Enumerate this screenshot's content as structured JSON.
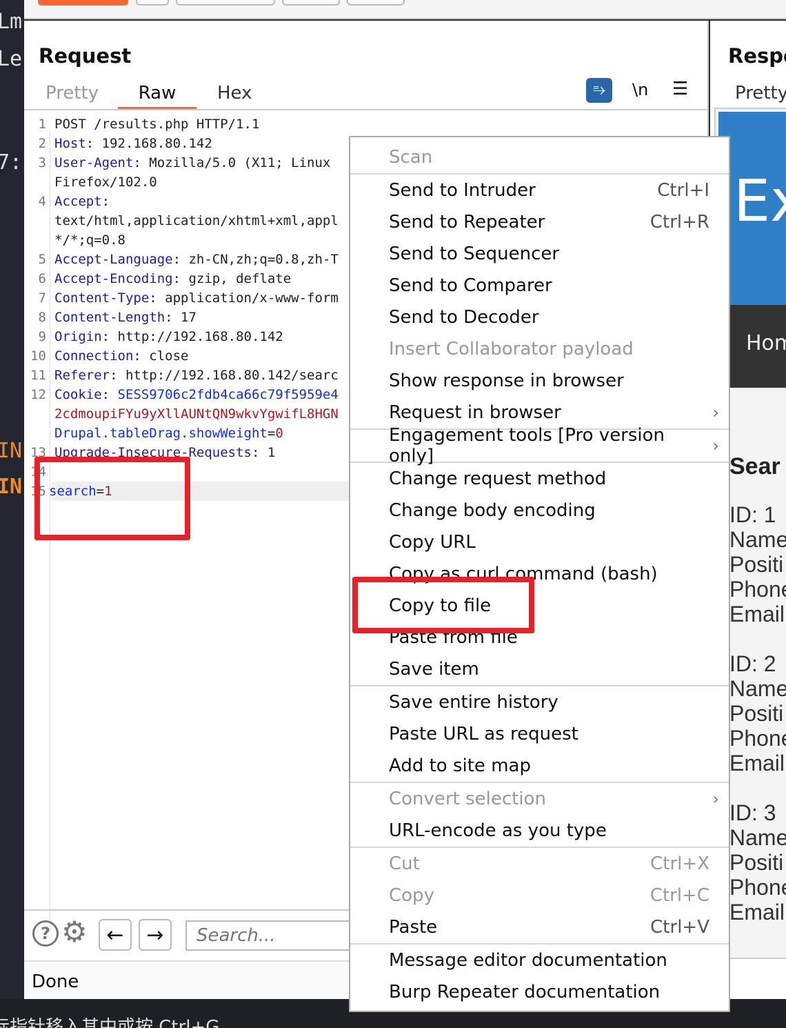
{
  "left_strip": {
    "fragments": [
      "Lm",
      "Le",
      "7:",
      "IN",
      "IN"
    ]
  },
  "request": {
    "title": "Request",
    "tabs": [
      {
        "label": "Pretty",
        "active": false
      },
      {
        "label": "Raw",
        "active": true
      },
      {
        "label": "Hex",
        "active": false
      }
    ],
    "toolbar": {
      "wrap_icon": "wrap-lines-icon",
      "newline_label": "\\n",
      "menu_icon": "hamburger-menu-icon"
    },
    "rows": [
      {
        "n": "1",
        "s": [
          {
            "t": "POST /results.php HTTP/1.1",
            "c": "v"
          }
        ]
      },
      {
        "n": "2",
        "s": [
          {
            "t": "Host",
            "c": "k"
          },
          {
            "t": ": 192.168.80.142",
            "c": "v"
          }
        ]
      },
      {
        "n": "3",
        "s": [
          {
            "t": "User-Agent",
            "c": "k"
          },
          {
            "t": ": Mozilla/5.0 (X11; Linux",
            "c": "v"
          }
        ]
      },
      {
        "n": "",
        "s": [
          {
            "t": "Firefox/102.0",
            "c": "v"
          }
        ]
      },
      {
        "n": "4",
        "s": [
          {
            "t": "Accept",
            "c": "k"
          },
          {
            "t": ":",
            "c": "v"
          }
        ]
      },
      {
        "n": "",
        "s": [
          {
            "t": "text/html,application/xhtml+xml,appl",
            "c": "v"
          }
        ]
      },
      {
        "n": "",
        "s": [
          {
            "t": "*/*;q=0.8",
            "c": "v"
          }
        ]
      },
      {
        "n": "5",
        "s": [
          {
            "t": "Accept-Language",
            "c": "k"
          },
          {
            "t": ": zh-CN,zh;q=0.8,zh-T",
            "c": "v"
          }
        ]
      },
      {
        "n": "6",
        "s": [
          {
            "t": "Accept-Encoding",
            "c": "k"
          },
          {
            "t": ": gzip, deflate",
            "c": "v"
          }
        ]
      },
      {
        "n": "7",
        "s": [
          {
            "t": "Content-Type",
            "c": "k"
          },
          {
            "t": ": application/x-www-form",
            "c": "v"
          }
        ]
      },
      {
        "n": "8",
        "s": [
          {
            "t": "Content-Length",
            "c": "k"
          },
          {
            "t": ": 17",
            "c": "v"
          }
        ]
      },
      {
        "n": "9",
        "s": [
          {
            "t": "Origin",
            "c": "k"
          },
          {
            "t": ": http://192.168.80.142",
            "c": "v"
          }
        ]
      },
      {
        "n": "10",
        "s": [
          {
            "t": "Connection",
            "c": "k"
          },
          {
            "t": ": close",
            "c": "v"
          }
        ]
      },
      {
        "n": "11",
        "s": [
          {
            "t": "Referer",
            "c": "k"
          },
          {
            "t": ": http://192.168.80.142/searc",
            "c": "v"
          }
        ]
      },
      {
        "n": "12",
        "s": [
          {
            "t": "Cookie",
            "c": "k"
          },
          {
            "t": ": ",
            "c": "v"
          },
          {
            "t": "SESS9706c2fdb4ca66c79f5959e4",
            "c": "cn"
          }
        ]
      },
      {
        "n": "",
        "s": [
          {
            "t": "2cdmoupiFYu9yXllAUNtQN9wkvYgwifL8HGN",
            "c": "cv"
          }
        ]
      },
      {
        "n": "",
        "s": [
          {
            "t": "Drupal.tableDrag.showWeight",
            "c": "cn"
          },
          {
            "t": "=",
            "c": "v"
          },
          {
            "t": "0",
            "c": "cv"
          }
        ]
      },
      {
        "n": "13",
        "s": [
          {
            "t": "Upgrade-Insecure-Requests",
            "c": "k"
          },
          {
            "t": ": 1",
            "c": "v"
          }
        ]
      },
      {
        "n": "14",
        "s": []
      },
      {
        "n": "15",
        "s": [
          {
            "t": "search",
            "c": "cn"
          },
          {
            "t": "=",
            "c": "v"
          },
          {
            "t": "1",
            "c": "cv"
          }
        ],
        "highlight": true
      }
    ],
    "search_placeholder": "Search...",
    "status": "Done"
  },
  "context_menu": {
    "groups": [
      [
        {
          "label": "Scan",
          "disabled": true
        }
      ],
      [
        {
          "label": "Send to Intruder",
          "shortcut": "Ctrl+I"
        },
        {
          "label": "Send to Repeater",
          "shortcut": "Ctrl+R"
        },
        {
          "label": "Send to Sequencer"
        },
        {
          "label": "Send to Comparer"
        },
        {
          "label": "Send to Decoder"
        },
        {
          "label": "Insert Collaborator payload",
          "disabled": true
        },
        {
          "label": "Show response in browser"
        },
        {
          "label": "Request in browser",
          "submenu": true
        }
      ],
      [
        {
          "label": "Engagement tools [Pro version only]",
          "submenu": true
        }
      ],
      [
        {
          "label": "Change request method"
        },
        {
          "label": "Change body encoding"
        },
        {
          "label": "Copy URL"
        },
        {
          "label": "Copy as curl command (bash)"
        },
        {
          "label": "Copy to file",
          "highlighted": true
        },
        {
          "label": "Paste from file"
        },
        {
          "label": "Save item"
        }
      ],
      [
        {
          "label": "Save entire history"
        },
        {
          "label": "Paste URL as request"
        },
        {
          "label": "Add to site map"
        }
      ],
      [
        {
          "label": "Convert selection",
          "disabled": true,
          "submenu": true
        },
        {
          "label": "URL-encode as you type"
        }
      ],
      [
        {
          "label": "Cut",
          "shortcut": "Ctrl+X",
          "disabled": true
        },
        {
          "label": "Copy",
          "shortcut": "Ctrl+C",
          "disabled": true
        },
        {
          "label": "Paste",
          "shortcut": "Ctrl+V"
        }
      ],
      [
        {
          "label": "Message editor documentation"
        },
        {
          "label": "Burp Repeater documentation"
        }
      ]
    ]
  },
  "response": {
    "title": "Respo",
    "tab": "Pretty",
    "banner": "Ex",
    "nav": "Hom",
    "heading": "Sear",
    "records": [
      [
        "ID: 1",
        "Name",
        "Positi",
        "Phone",
        "Email"
      ],
      [
        "ID: 2",
        "Name",
        "Positi",
        "Phone",
        "Email"
      ],
      [
        "ID: 3",
        "Name",
        "Positi",
        "Phone",
        "Email"
      ]
    ]
  },
  "taskbar_text": "标指针移入其中或按 Ctrl+G",
  "colors": {
    "accent": "#ff6633",
    "highlight_box": "#e8202a",
    "banner_blue": "#2e7fc8",
    "nav_dark": "#333333",
    "wrap_button": "#2a67a8"
  }
}
